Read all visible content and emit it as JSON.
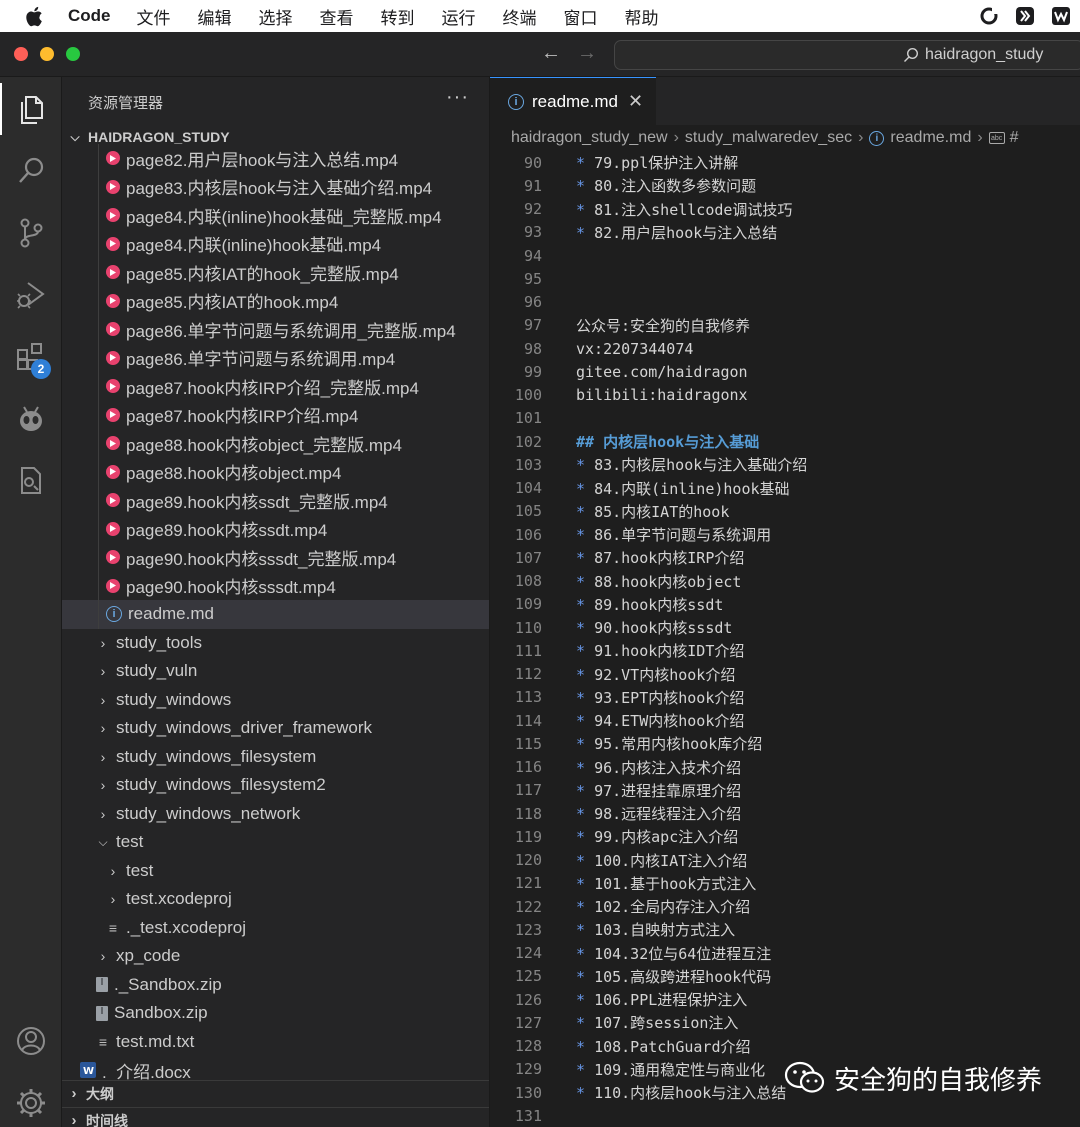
{
  "menubar": {
    "app": "Code",
    "items": [
      "文件",
      "编辑",
      "选择",
      "查看",
      "转到",
      "运行",
      "终端",
      "窗口",
      "帮助"
    ]
  },
  "titlebar": {
    "command_center": "haidragon_study"
  },
  "activitybar": {
    "extensions_badge": "2"
  },
  "sidebar": {
    "header": "资源管理器",
    "more": "···",
    "root": "HAIDRAGON_STUDY",
    "items": [
      {
        "label": "page82.用户层hook与注入总结.mp4",
        "kind": "mp4",
        "indent": 2
      },
      {
        "label": "page83.内核层hook与注入基础介绍.mp4",
        "kind": "mp4",
        "indent": 2
      },
      {
        "label": "page84.内联(inline)hook基础_完整版.mp4",
        "kind": "mp4",
        "indent": 2
      },
      {
        "label": "page84.内联(inline)hook基础.mp4",
        "kind": "mp4",
        "indent": 2
      },
      {
        "label": "page85.内核IAT的hook_完整版.mp4",
        "kind": "mp4",
        "indent": 2
      },
      {
        "label": "page85.内核IAT的hook.mp4",
        "kind": "mp4",
        "indent": 2
      },
      {
        "label": "page86.单字节问题与系统调用_完整版.mp4",
        "kind": "mp4",
        "indent": 2
      },
      {
        "label": "page86.单字节问题与系统调用.mp4",
        "kind": "mp4",
        "indent": 2
      },
      {
        "label": "page87.hook内核IRP介绍_完整版.mp4",
        "kind": "mp4",
        "indent": 2
      },
      {
        "label": "page87.hook内核IRP介绍.mp4",
        "kind": "mp4",
        "indent": 2
      },
      {
        "label": "page88.hook内核object_完整版.mp4",
        "kind": "mp4",
        "indent": 2
      },
      {
        "label": "page88.hook内核object.mp4",
        "kind": "mp4",
        "indent": 2
      },
      {
        "label": "page89.hook内核ssdt_完整版.mp4",
        "kind": "mp4",
        "indent": 2
      },
      {
        "label": "page89.hook内核ssdt.mp4",
        "kind": "mp4",
        "indent": 2
      },
      {
        "label": "page90.hook内核sssdt_完整版.mp4",
        "kind": "mp4",
        "indent": 2
      },
      {
        "label": "page90.hook内核sssdt.mp4",
        "kind": "mp4",
        "indent": 2
      },
      {
        "label": "readme.md",
        "kind": "info",
        "indent": 2,
        "selected": true
      },
      {
        "label": "study_tools",
        "kind": "folder",
        "indent": 1
      },
      {
        "label": "study_vuln",
        "kind": "folder",
        "indent": 1
      },
      {
        "label": "study_windows",
        "kind": "folder",
        "indent": 1
      },
      {
        "label": "study_windows_driver_framework",
        "kind": "folder",
        "indent": 1
      },
      {
        "label": "study_windows_filesystem",
        "kind": "folder",
        "indent": 1
      },
      {
        "label": "study_windows_filesystem2",
        "kind": "folder",
        "indent": 1
      },
      {
        "label": "study_windows_network",
        "kind": "folder",
        "indent": 1
      },
      {
        "label": "test",
        "kind": "folder-open",
        "indent": 1
      },
      {
        "label": "test",
        "kind": "folder",
        "indent": 2
      },
      {
        "label": "test.xcodeproj",
        "kind": "folder",
        "indent": 2
      },
      {
        "label": "._test.xcodeproj",
        "kind": "lines",
        "indent": 2
      },
      {
        "label": "xp_code",
        "kind": "folder",
        "indent": 1
      },
      {
        "label": "._Sandbox.zip",
        "kind": "zip",
        "indent": 1
      },
      {
        "label": "Sandbox.zip",
        "kind": "zip",
        "indent": 1
      },
      {
        "label": "test.md.txt",
        "kind": "lines",
        "indent": 1
      },
      {
        "label": "._介绍.docx",
        "kind": "docx",
        "indent": 0
      }
    ],
    "bottom_sections": [
      "大纲",
      "时间线"
    ]
  },
  "editor": {
    "tab": {
      "label": "readme.md",
      "close": "✕"
    },
    "breadcrumb": [
      "haidragon_study_new",
      "study_malwaredev_sec",
      "readme.md",
      "#"
    ],
    "lines": [
      {
        "n": "90",
        "bullet": true,
        "text": "79.ppl保护注入讲解"
      },
      {
        "n": "91",
        "bullet": true,
        "text": "80.注入函数多参数问题"
      },
      {
        "n": "92",
        "bullet": true,
        "text": "81.注入shellcode调试技巧"
      },
      {
        "n": "93",
        "bullet": true,
        "text": "82.用户层hook与注入总结"
      },
      {
        "n": "94",
        "bullet": false,
        "text": ""
      },
      {
        "n": "95",
        "bullet": false,
        "text": ""
      },
      {
        "n": "96",
        "bullet": false,
        "text": ""
      },
      {
        "n": "97",
        "bullet": false,
        "text": "公众号:安全狗的自我修养"
      },
      {
        "n": "98",
        "bullet": false,
        "text": "vx:2207344074"
      },
      {
        "n": "99",
        "bullet": false,
        "text": "gitee.com/haidragon"
      },
      {
        "n": "100",
        "bullet": false,
        "text": "bilibili:haidragonx"
      },
      {
        "n": "101",
        "bullet": false,
        "text": ""
      },
      {
        "n": "102",
        "bullet": false,
        "heading": true,
        "text": "## 内核层hook与注入基础"
      },
      {
        "n": "103",
        "bullet": true,
        "text": "83.内核层hook与注入基础介绍"
      },
      {
        "n": "104",
        "bullet": true,
        "text": "84.内联(inline)hook基础"
      },
      {
        "n": "105",
        "bullet": true,
        "text": "85.内核IAT的hook"
      },
      {
        "n": "106",
        "bullet": true,
        "text": "86.单字节问题与系统调用"
      },
      {
        "n": "107",
        "bullet": true,
        "text": "87.hook内核IRP介绍"
      },
      {
        "n": "108",
        "bullet": true,
        "text": "88.hook内核object"
      },
      {
        "n": "109",
        "bullet": true,
        "text": "89.hook内核ssdt"
      },
      {
        "n": "110",
        "bullet": true,
        "text": "90.hook内核sssdt"
      },
      {
        "n": "111",
        "bullet": true,
        "text": "91.hook内核IDT介绍"
      },
      {
        "n": "112",
        "bullet": true,
        "text": "92.VT内核hook介绍"
      },
      {
        "n": "113",
        "bullet": true,
        "text": "93.EPT内核hook介绍"
      },
      {
        "n": "114",
        "bullet": true,
        "text": "94.ETW内核hook介绍"
      },
      {
        "n": "115",
        "bullet": true,
        "text": "95.常用内核hook库介绍"
      },
      {
        "n": "116",
        "bullet": true,
        "text": "96.内核注入技术介绍"
      },
      {
        "n": "117",
        "bullet": true,
        "text": "97.进程挂靠原理介绍"
      },
      {
        "n": "118",
        "bullet": true,
        "text": "98.远程线程注入介绍"
      },
      {
        "n": "119",
        "bullet": true,
        "text": "99.内核apc注入介绍"
      },
      {
        "n": "120",
        "bullet": true,
        "text": "100.内核IAT注入介绍"
      },
      {
        "n": "121",
        "bullet": true,
        "text": "101.基于hook方式注入"
      },
      {
        "n": "122",
        "bullet": true,
        "text": "102.全局内存注入介绍"
      },
      {
        "n": "123",
        "bullet": true,
        "text": "103.自映射方式注入"
      },
      {
        "n": "124",
        "bullet": true,
        "text": "104.32位与64位进程互注"
      },
      {
        "n": "125",
        "bullet": true,
        "text": "105.高级跨进程hook代码"
      },
      {
        "n": "126",
        "bullet": true,
        "text": "106.PPL进程保护注入"
      },
      {
        "n": "127",
        "bullet": true,
        "text": "107.跨session注入"
      },
      {
        "n": "128",
        "bullet": true,
        "text": "108.PatchGuard介绍"
      },
      {
        "n": "129",
        "bullet": true,
        "text": "109.通用稳定性与商业化"
      },
      {
        "n": "130",
        "bullet": true,
        "text": "110.内核层hook与注入总结"
      },
      {
        "n": "131",
        "bullet": false,
        "text": ""
      }
    ]
  },
  "watermark": {
    "text": "安全狗的自我修养"
  },
  "colors": {
    "accent": "#3794ff",
    "mp4": "#e8426e",
    "markdown_bullet": "#6796e6",
    "heading": "#569cd6"
  }
}
